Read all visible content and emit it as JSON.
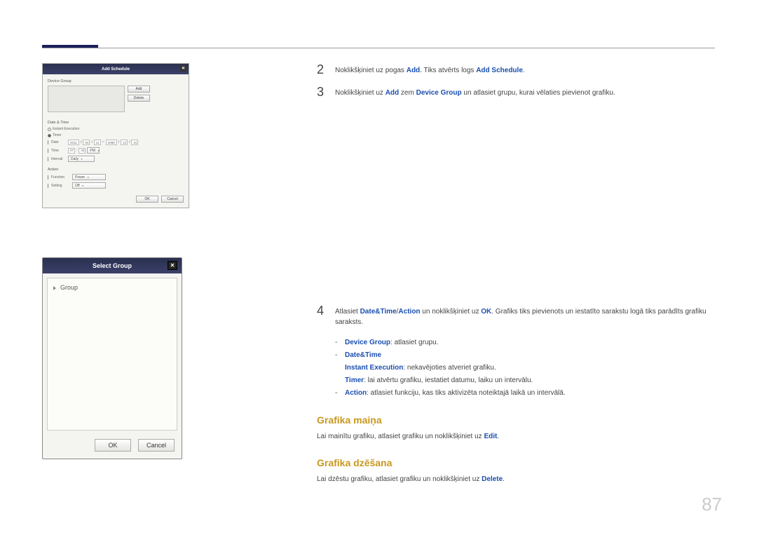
{
  "page_number": "87",
  "steps": {
    "s2": {
      "num": "2",
      "pre": "Noklikšķiniet uz pogas ",
      "add": "Add",
      "mid": ". Tiks atvērts logs ",
      "add_schedule": "Add Schedule",
      "post": "."
    },
    "s3": {
      "num": "3",
      "pre": "Noklikšķiniet uz ",
      "add": "Add",
      "mid": " zem ",
      "dg": "Device Group",
      "post": " un atlasiet grupu, kurai vēlaties pievienot grafiku."
    },
    "s4": {
      "num": "4",
      "pre": "Atlasiet ",
      "dt": "Date&Time",
      "slash": "/",
      "action": "Action",
      "mid": " un noklikšķiniet uz ",
      "ok": "OK",
      "post": ". Grafiks tiks pievienots un iestatīto sarakstu logā tiks parādīts grafiku saraksts."
    }
  },
  "sublist": {
    "row1": {
      "blue": "Device Group",
      "rest": ": atlasiet grupu."
    },
    "row2": {
      "blue": "Date&Time"
    },
    "row3": {
      "blue": "Instant Execution",
      "rest": ": nekavējoties atveriet grafiku."
    },
    "row4": {
      "blue": "Timer",
      "rest": ": lai atvērtu grafiku, iestatiet datumu, laiku un intervālu."
    },
    "row5": {
      "blue": "Action",
      "rest": ":  atlasiet funkciju, kas tiks aktivizēta noteiktajā laikā un intervālā."
    }
  },
  "headings": {
    "h1": "Grafika maiņa",
    "h2": "Grafika dzēšana"
  },
  "para1": {
    "pre": "Lai mainītu grafiku, atlasiet grafiku un noklikšķiniet uz ",
    "link": "Edit",
    "post": "."
  },
  "para2": {
    "pre": "Lai dzēstu grafiku, atlasiet grafiku un noklikšķiniet uz ",
    "link": "Delete",
    "post": "."
  },
  "dialog1": {
    "title": "Add Schedule",
    "device_group": "Device Group",
    "add": "Add",
    "delete": "Delete",
    "date_time": "Date & Time",
    "instant": "Instant Execution",
    "timer": "Timer",
    "date_label": "Date",
    "date_v1": "2011",
    "date_v2": "04",
    "date_v3": "11",
    "date_sep": "~",
    "date_v4": "2088",
    "date_v5": "13",
    "date_v6": "31",
    "time_label": "Time",
    "time_v1": "07",
    "time_v2": "33",
    "time_ap": "PM",
    "interval_label": "Interval",
    "interval_val": "Daily",
    "action": "Action",
    "function_label": "Function",
    "function_val": "Power",
    "setting_label": "Setting",
    "setting_val": "Off",
    "ok": "OK",
    "cancel": "Cancel"
  },
  "dialog2": {
    "title": "Select Group",
    "group": "Group",
    "ok": "OK",
    "cancel": "Cancel"
  }
}
